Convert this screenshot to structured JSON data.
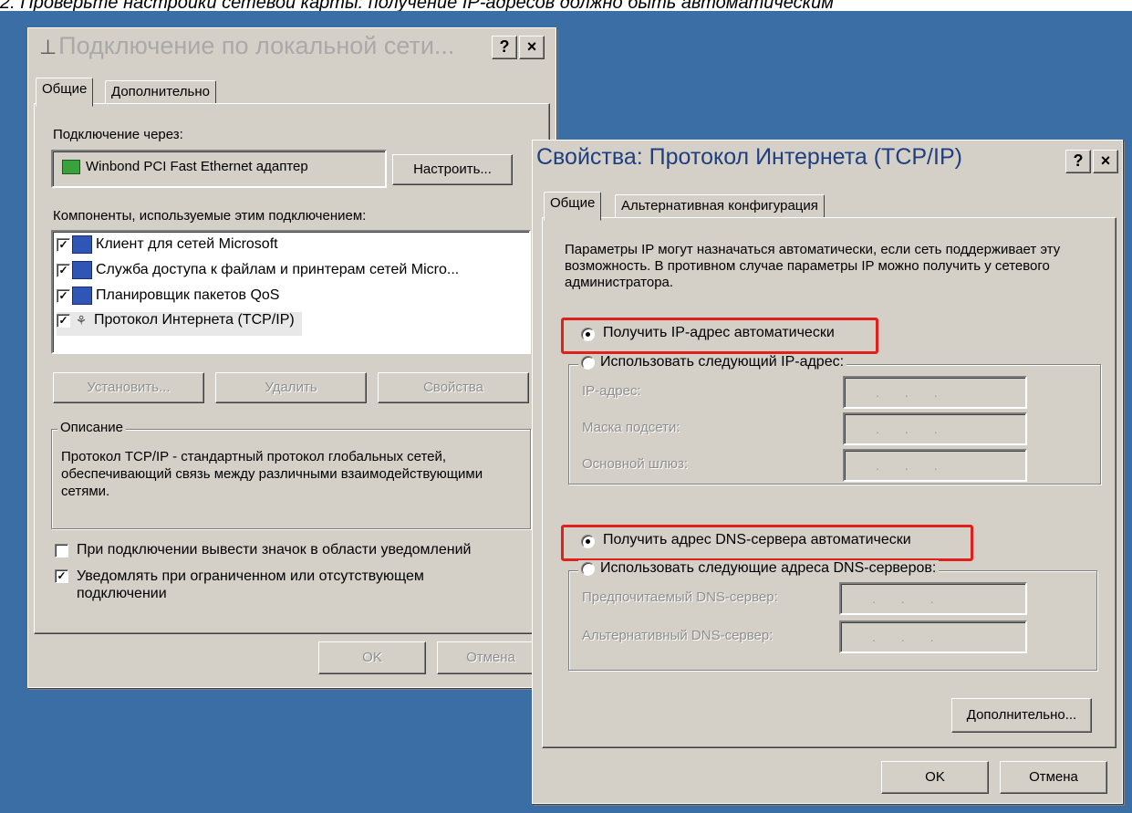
{
  "caption": "2. Проверьте настройки сетевой карты: получение IP-адресов должно быть автоматическим",
  "colors": {
    "desktop": "#3a6ea5",
    "dialog": "#d4d0c8",
    "highlight": "#e1201b",
    "title_active": "#1f3f7f",
    "title_inactive": "#a9a9a9"
  },
  "window1": {
    "title": "Подключение по локальной сети...",
    "icon": "network-connection-icon",
    "help_label": "?",
    "close_label": "×",
    "tabs": [
      "Общие",
      "Дополнительно"
    ],
    "connect_via_label": "Подключение через:",
    "adapter_name": "Winbond PCI Fast Ethernet адаптер",
    "configure_label": "Настроить...",
    "components_label": "Компоненты, используемые этим подключением:",
    "components": [
      {
        "label": "Клиент для сетей Microsoft",
        "checked": true,
        "icon": "network-client-icon"
      },
      {
        "label": "Служба доступа к файлам и принтерам сетей Micro...",
        "checked": true,
        "icon": "file-printer-sharing-icon"
      },
      {
        "label": "Планировщик пакетов QoS",
        "checked": true,
        "icon": "qos-scheduler-icon"
      },
      {
        "label": "Протокол Интернета (TCP/IP)",
        "checked": true,
        "icon": "network-protocol-icon"
      }
    ],
    "install_label": "Установить...",
    "remove_label": "Удалить",
    "properties_label": "Свойства",
    "description_title": "Описание",
    "description_text": "Протокол TCP/IP - стандартный протокол глобальных сетей, обеспечивающий связь между различными взаимодействующими сетями.",
    "show_icon_label": "При подключении вывести значок в области уведомлений",
    "show_icon_checked": false,
    "notify_label": "Уведомлять при ограниченном или отсутствующем подключении",
    "notify_checked": true,
    "ok_label": "OK",
    "cancel_label": "Отмена"
  },
  "window2": {
    "title": "Свойства: Протокол Интернета (TCP/IP)",
    "help_label": "?",
    "close_label": "×",
    "tabs": [
      "Общие",
      "Альтернативная конфигурация"
    ],
    "info_text": "Параметры IP могут назначаться автоматически, если сеть поддерживает эту возможность. В противном случае параметры IP можно получить у сетевого администратора.",
    "ip_auto_label": "Получить IP-адрес автоматически",
    "ip_auto_selected": true,
    "ip_manual_label": "Использовать следующий IP-адрес:",
    "ip_address_label": "IP-адрес:",
    "subnet_label": "Маска подсети:",
    "gateway_label": "Основной шлюз:",
    "ip_field_placeholder": "...",
    "dns_auto_label": "Получить адрес DNS-сервера автоматически",
    "dns_auto_selected": true,
    "dns_manual_label": "Использовать следующие адреса DNS-серверов:",
    "preferred_dns_label": "Предпочитаемый DNS-сервер:",
    "alternate_dns_label": "Альтернативный DNS-сервер:",
    "advanced_label": "Дополнительно...",
    "ok_label": "OK",
    "cancel_label": "Отмена"
  }
}
